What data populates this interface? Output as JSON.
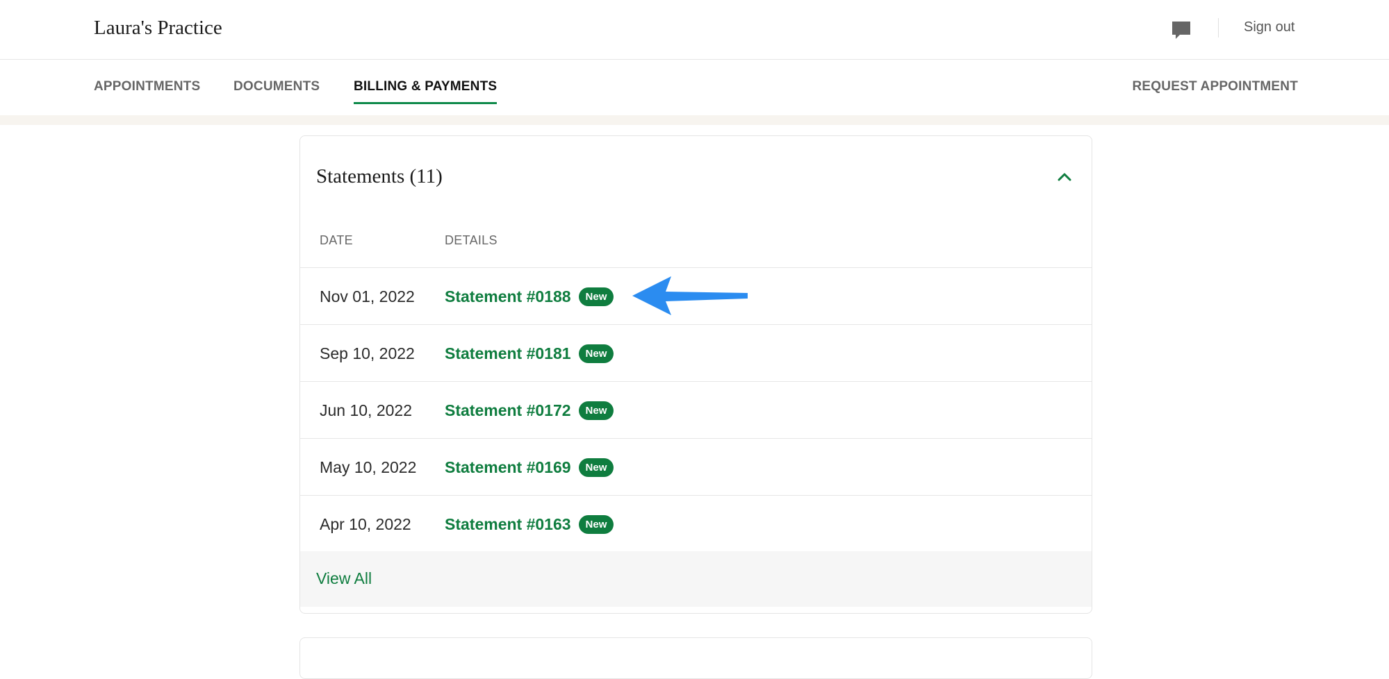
{
  "header": {
    "brand": "Laura's Practice",
    "chat_icon": "chat-bubble-icon",
    "sign_out": "Sign out"
  },
  "nav": {
    "tabs": [
      {
        "label": "APPOINTMENTS",
        "active": false
      },
      {
        "label": "DOCUMENTS",
        "active": false
      },
      {
        "label": "BILLING & PAYMENTS",
        "active": true
      }
    ],
    "request_appointment": "REQUEST APPOINTMENT"
  },
  "statements": {
    "title": "Statements (11)",
    "toggle_icon": "chevron-up-icon",
    "columns": {
      "date": "DATE",
      "details": "DETAILS"
    },
    "rows": [
      {
        "date": "Nov 01, 2022",
        "statement": "Statement #0188",
        "badge": "New"
      },
      {
        "date": "Sep 10, 2022",
        "statement": "Statement #0181",
        "badge": "New"
      },
      {
        "date": "Jun 10, 2022",
        "statement": "Statement #0172",
        "badge": "New"
      },
      {
        "date": "May 10, 2022",
        "statement": "Statement #0169",
        "badge": "New"
      },
      {
        "date": "Apr 10, 2022",
        "statement": "Statement #0163",
        "badge": "New"
      }
    ],
    "view_all": "View All"
  },
  "annotation": {
    "icon": "blue-arrow-icon",
    "color": "#2b8cf0"
  },
  "colors": {
    "accent": "#0f7d3f",
    "tab_underline": "#0f8a4a"
  }
}
